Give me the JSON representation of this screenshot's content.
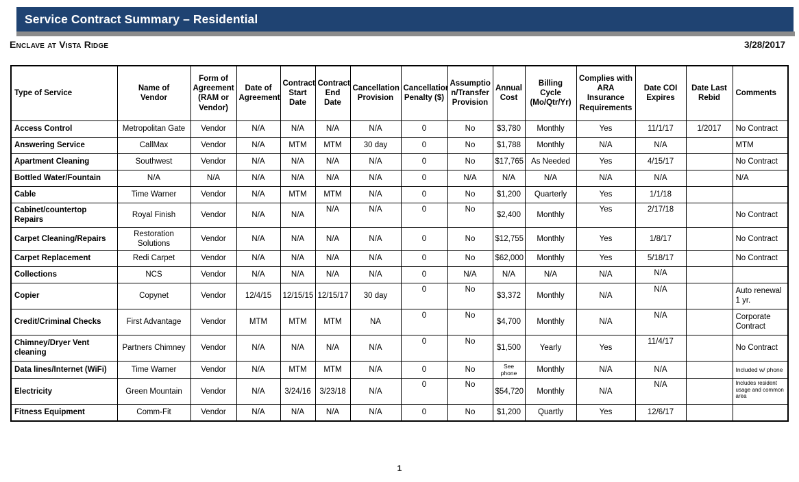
{
  "header": {
    "title": "Service Contract Summary – Residential",
    "banner_color": "#1F4372",
    "accent_color": "#8C8C8C",
    "property_name": "Enclave at Vista Ridge",
    "report_date": "3/28/2017"
  },
  "table": {
    "columns": [
      "Type of Service",
      "Name of Vendor",
      "Form of Agreement (RAM or Vendor)",
      "Date of Agreement",
      "Contract Start Date",
      "Contract End Date",
      "Cancellation Provision",
      "Cancellation Penalty ($)",
      "Assumption/Transfer Provision",
      "Annual Cost",
      "Billing Cycle (Mo/Qtr/Yr)",
      "Complies with ARA Insurance Requirements",
      "Date COI Expires",
      "Date Last Rebid",
      "Comments"
    ],
    "column_lines": [
      [
        "Type of Service"
      ],
      [
        "Name of",
        "Vendor"
      ],
      [
        "Form of",
        "Agreement",
        "(RAM or",
        "Vendor)"
      ],
      [
        "Date of",
        "Agreement"
      ],
      [
        "Contract",
        "Start",
        "Date"
      ],
      [
        "Contract",
        "End",
        "Date"
      ],
      [
        "Cancellation",
        "Provision"
      ],
      [
        "Cancellation",
        "Penalty ($)"
      ],
      [
        "Assumptio",
        "n/Transfer",
        "Provision"
      ],
      [
        "Annual",
        "Cost"
      ],
      [
        "Billing Cycle",
        "(Mo/Qtr/Yr)"
      ],
      [
        "Complies with",
        "ARA Insurance",
        "Requirements"
      ],
      [
        "Date COI",
        "Expires"
      ],
      [
        "Date Last",
        "Rebid"
      ],
      [
        "Comments"
      ]
    ],
    "rows": [
      {
        "service": "Access Control",
        "vendor": "Metropolitan Gate",
        "form": "Vendor",
        "date_agreement": "N/A",
        "contract_start": "N/A",
        "contract_end": "N/A",
        "cancellation_provision": "N/A",
        "cancellation_penalty": "0",
        "assumption": "No",
        "annual_cost": "$3,780",
        "billing_cycle": "Monthly",
        "complies": "Yes",
        "coi_expires": "11/1/17",
        "last_rebid": "1/2017",
        "comments": "No Contract"
      },
      {
        "service": "Answering Service",
        "vendor": "CallMax",
        "form": "Vendor",
        "date_agreement": "N/A",
        "contract_start": "MTM",
        "contract_end": "MTM",
        "cancellation_provision": "30 day",
        "cancellation_penalty": "0",
        "assumption": "No",
        "annual_cost": "$1,788",
        "billing_cycle": "Monthly",
        "complies": "N/A",
        "coi_expires": "N/A",
        "last_rebid": "",
        "comments": "MTM"
      },
      {
        "service": "Apartment Cleaning",
        "vendor": "Southwest",
        "form": "Vendor",
        "date_agreement": "N/A",
        "contract_start": "N/A",
        "contract_end": "N/A",
        "cancellation_provision": "N/A",
        "cancellation_penalty": "0",
        "assumption": "No",
        "annual_cost": "$17,765",
        "billing_cycle": "As Needed",
        "complies": "Yes",
        "coi_expires": "4/15/17",
        "last_rebid": "",
        "comments": "No Contract"
      },
      {
        "service": "Bottled Water/Fountain",
        "vendor": "N/A",
        "form": "N/A",
        "date_agreement": "N/A",
        "contract_start": "N/A",
        "contract_end": "N/A",
        "cancellation_provision": "N/A",
        "cancellation_penalty": "0",
        "assumption": "N/A",
        "annual_cost": "N/A",
        "billing_cycle": "N/A",
        "complies": "N/A",
        "coi_expires": "N/A",
        "last_rebid": "",
        "comments": "N/A"
      },
      {
        "service": "Cable",
        "vendor": "Time Warner",
        "form": "Vendor",
        "date_agreement": "N/A",
        "contract_start": "MTM",
        "contract_end": "MTM",
        "cancellation_provision": "N/A",
        "cancellation_penalty": "0",
        "assumption": "No",
        "annual_cost": "$1,200",
        "billing_cycle": "Quarterly",
        "complies": "Yes",
        "coi_expires": "1/1/18",
        "last_rebid": "",
        "comments": ""
      },
      {
        "service": "Cabinet/countertop Repairs",
        "vendor": "Royal Finish",
        "form": "Vendor",
        "date_agreement": "N/A",
        "contract_start": "N/A",
        "contract_end": "N/A",
        "cancellation_provision": "N/A",
        "cancellation_penalty": "0",
        "assumption": "No",
        "annual_cost": "$2,400",
        "billing_cycle": "Monthly",
        "complies": "Yes",
        "coi_expires": "2/17/18",
        "last_rebid": "",
        "comments": "No Contract"
      },
      {
        "service": "Carpet Cleaning/Repairs",
        "vendor": "Restoration Solutions",
        "form": "Vendor",
        "date_agreement": "N/A",
        "contract_start": "N/A",
        "contract_end": "N/A",
        "cancellation_provision": "N/A",
        "cancellation_penalty": "0",
        "assumption": "No",
        "annual_cost": "$12,755",
        "billing_cycle": "Monthly",
        "complies": "Yes",
        "coi_expires": "1/8/17",
        "last_rebid": "",
        "comments": "No Contract"
      },
      {
        "service": "Carpet Replacement",
        "vendor": "Redi Carpet",
        "form": "Vendor",
        "date_agreement": "N/A",
        "contract_start": "N/A",
        "contract_end": "N/A",
        "cancellation_provision": "N/A",
        "cancellation_penalty": "0",
        "assumption": "No",
        "annual_cost": "$62,000",
        "billing_cycle": "Monthly",
        "complies": "Yes",
        "coi_expires": "5/18/17",
        "last_rebid": "",
        "comments": "No Contract"
      },
      {
        "service": "Collections",
        "vendor": "NCS",
        "form": "Vendor",
        "date_agreement": "N/A",
        "contract_start": "N/A",
        "contract_end": "N/A",
        "cancellation_provision": "N/A",
        "cancellation_penalty": "0",
        "assumption": "N/A",
        "annual_cost": "N/A",
        "billing_cycle": "N/A",
        "complies": "N/A",
        "coi_expires": "N/A",
        "last_rebid": "",
        "comments": ""
      },
      {
        "service": "Copier",
        "vendor": "Copynet",
        "form": "Vendor",
        "date_agreement": "12/4/15",
        "contract_start": "12/15/15",
        "contract_end": "12/15/17",
        "cancellation_provision": "30 day",
        "cancellation_penalty": "0",
        "assumption": "No",
        "annual_cost": "$3,372",
        "billing_cycle": "Monthly",
        "complies": "N/A",
        "coi_expires": "N/A",
        "last_rebid": "",
        "comments": "Auto renewal 1 yr."
      },
      {
        "service": "Credit/Criminal Checks",
        "vendor": "First Advantage",
        "form": "Vendor",
        "date_agreement": "MTM",
        "contract_start": "MTM",
        "contract_end": "MTM",
        "cancellation_provision": "NA",
        "cancellation_penalty": "0",
        "assumption": "No",
        "annual_cost": "$4,700",
        "billing_cycle": "Monthly",
        "complies": "N/A",
        "coi_expires": "N/A",
        "last_rebid": "",
        "comments": "Corporate Contract"
      },
      {
        "service": "Chimney/Dryer Vent cleaning",
        "vendor": "Partners Chimney",
        "form": "Vendor",
        "date_agreement": "N/A",
        "contract_start": "N/A",
        "contract_end": "N/A",
        "cancellation_provision": "N/A",
        "cancellation_penalty": "0",
        "assumption": "No",
        "annual_cost": "$1,500",
        "billing_cycle": "Yearly",
        "complies": "Yes",
        "coi_expires": "11/4/17",
        "last_rebid": "",
        "comments": "No Contract"
      },
      {
        "service": "Data lines/Internet (WiFi)",
        "vendor": "Time Warner",
        "form": "Vendor",
        "date_agreement": "N/A",
        "contract_start": "MTM",
        "contract_end": "MTM",
        "cancellation_provision": "N/A",
        "cancellation_penalty": "0",
        "assumption": "No",
        "annual_cost": "See phone",
        "billing_cycle": "Monthly",
        "complies": "N/A",
        "coi_expires": "N/A",
        "last_rebid": "",
        "comments": "Included w/ phone"
      },
      {
        "service": "Electricity",
        "vendor": "Green Mountain",
        "form": "Vendor",
        "date_agreement": "N/A",
        "contract_start": "3/24/16",
        "contract_end": "3/23/18",
        "cancellation_provision": "N/A",
        "cancellation_penalty": "0",
        "assumption": "No",
        "annual_cost": "$54,720",
        "billing_cycle": "Monthly",
        "complies": "N/A",
        "coi_expires": "N/A",
        "last_rebid": "",
        "comments": "Includes resident usage and common area"
      },
      {
        "service": "Fitness Equipment",
        "vendor": "Comm-Fit",
        "form": "Vendor",
        "date_agreement": "N/A",
        "contract_start": "N/A",
        "contract_end": "N/A",
        "cancellation_provision": "N/A",
        "cancellation_penalty": "0",
        "assumption": "No",
        "annual_cost": "$1,200",
        "billing_cycle": "Quartly",
        "complies": "Yes",
        "coi_expires": "12/6/17",
        "last_rebid": "",
        "comments": ""
      }
    ]
  },
  "footer": {
    "page_number": "1"
  }
}
